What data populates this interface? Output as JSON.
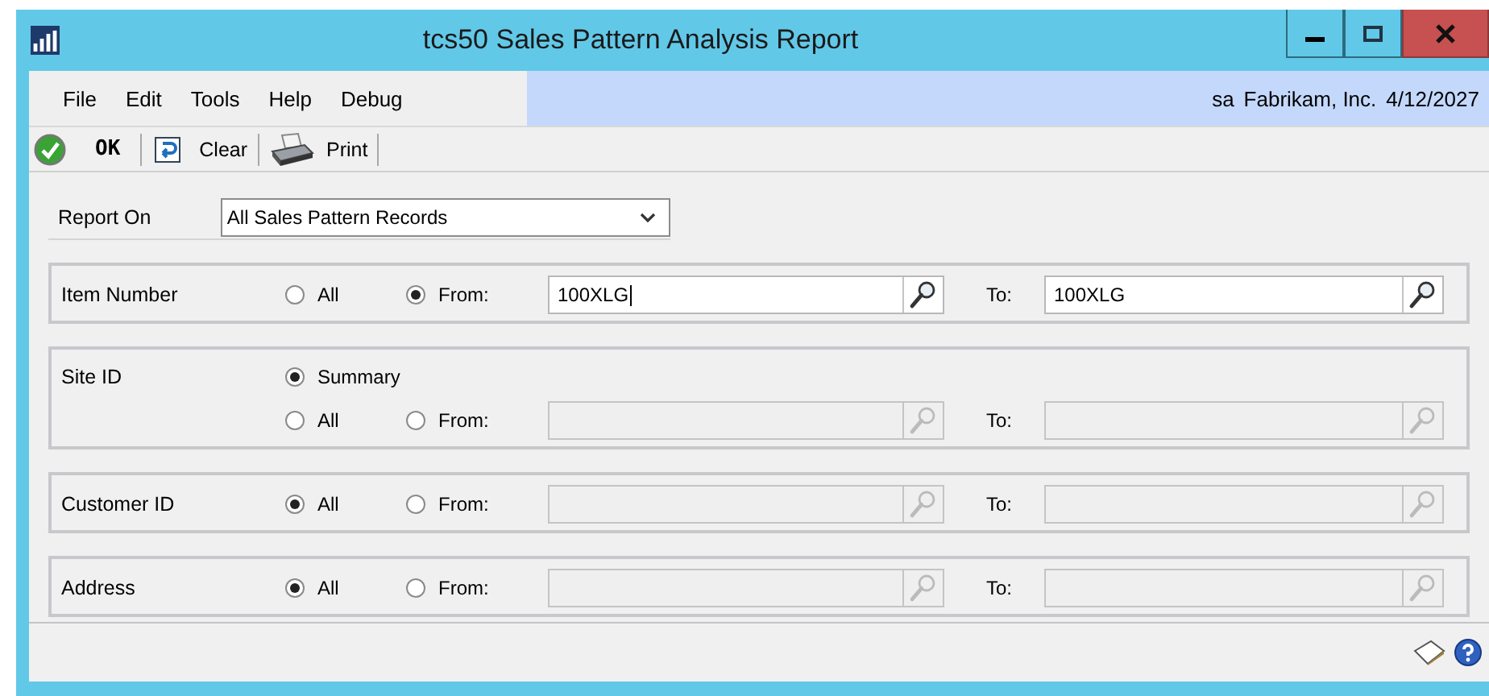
{
  "window": {
    "title": "tcs50 Sales Pattern Analysis Report"
  },
  "menu": [
    {
      "label": "File"
    },
    {
      "label": "Edit"
    },
    {
      "label": "Tools"
    },
    {
      "label": "Help"
    },
    {
      "label": "Debug"
    }
  ],
  "session": {
    "user": "sa",
    "company": "Fabrikam, Inc.",
    "date": "4/12/2027"
  },
  "toolbar": [
    {
      "kind": "ok",
      "label": "OK"
    },
    {
      "kind": "clear",
      "label": "Clear"
    },
    {
      "kind": "print",
      "label": "Print"
    }
  ],
  "report_on": {
    "label": "Report On",
    "value": "All Sales Pattern Records"
  },
  "ranges": [
    {
      "label": "Item Number",
      "all": {
        "label": "All",
        "selected": false
      },
      "from": {
        "label": "From:",
        "selected": true
      },
      "from_field": {
        "value": "100XLG",
        "focused": true,
        "disabled": false
      },
      "to_label": "To:",
      "to_field": {
        "value": "100XLG",
        "focused": false,
        "disabled": false
      }
    },
    {
      "label": "Site ID",
      "summary": {
        "label": "Summary",
        "selected": true
      },
      "all": {
        "label": "All",
        "selected": false
      },
      "from": {
        "label": "From:",
        "selected": false
      },
      "from_field": {
        "focused": false,
        "disabled": true
      },
      "to_label": "To:",
      "to_field": {
        "focused": false,
        "disabled": true
      }
    },
    {
      "label": "Customer ID",
      "all": {
        "label": "All",
        "selected": true
      },
      "from": {
        "label": "From:",
        "selected": false
      },
      "from_field": {
        "focused": false,
        "disabled": true
      },
      "to_label": "To:",
      "to_field": {
        "focused": false,
        "disabled": true
      }
    },
    {
      "label": "Address",
      "all": {
        "label": "All",
        "selected": true
      },
      "from": {
        "label": "From:",
        "selected": false
      },
      "from_field": {
        "focused": false,
        "disabled": true
      },
      "to_label": "To:",
      "to_field": {
        "focused": false,
        "disabled": true
      }
    }
  ]
}
